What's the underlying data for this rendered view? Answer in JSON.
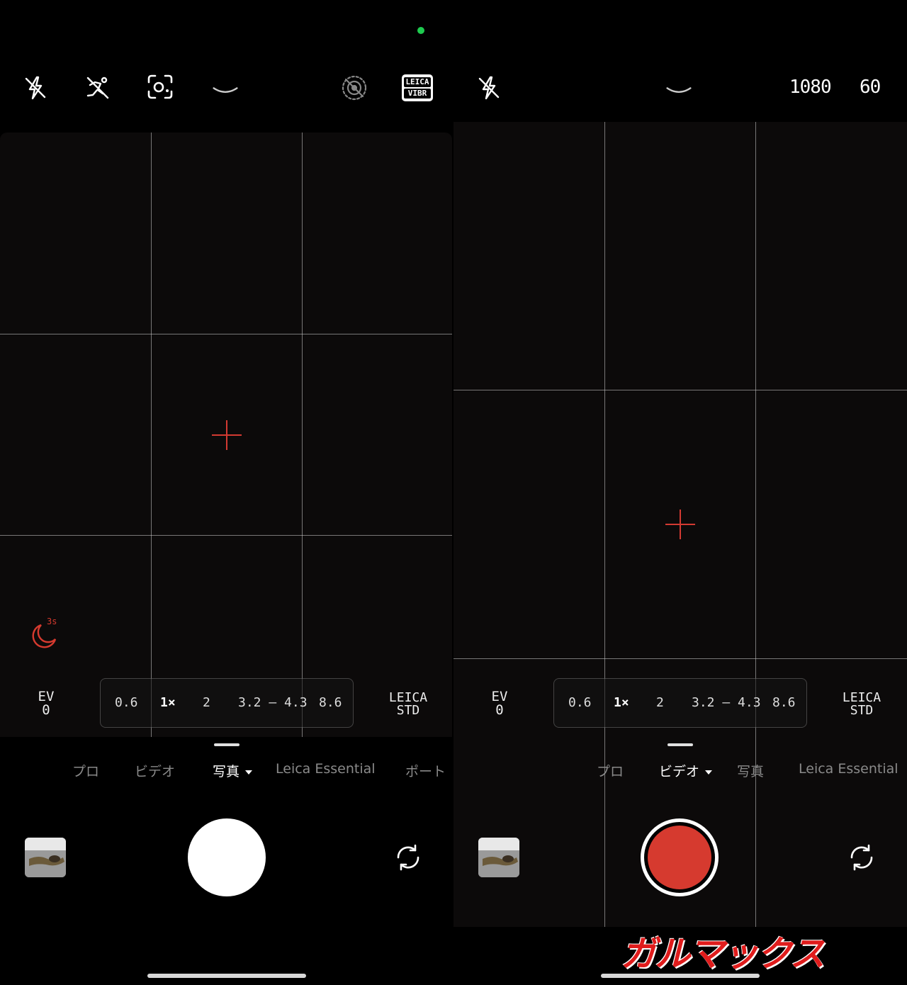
{
  "photo_screen": {
    "top_bar_icons": [
      "flash-off-icon",
      "motion-off-icon",
      "lens-scan-icon",
      "chevron-down-icon",
      "live-photo-off-icon",
      "leica-vibrant-badge"
    ],
    "leica_badge": {
      "line1": "LEICA",
      "line2": "VIBR"
    },
    "night_timer_label": "3s",
    "ev": {
      "label": "EV",
      "value": "0"
    },
    "zoom_levels": [
      "0.6",
      "1×",
      "2",
      "3.2 – 4.3",
      "8.6"
    ],
    "color_profile": {
      "line1": "LEICA",
      "line2": "STD"
    },
    "modes": [
      "プロ",
      "ビデオ",
      "写真",
      "Leica Essential",
      "ポート"
    ],
    "active_mode": "写真"
  },
  "video_screen": {
    "top_bar_icons": [
      "flash-off-icon",
      "chevron-down-icon"
    ],
    "resolution": "1080",
    "fps": "60",
    "ev": {
      "label": "EV",
      "value": "0"
    },
    "zoom_levels": [
      "0.6",
      "1×",
      "2",
      "3.2 – 4.3",
      "8.6"
    ],
    "color_profile": {
      "line1": "LEICA",
      "line2": "STD"
    },
    "modes": [
      "プロ",
      "ビデオ",
      "写真",
      "Leica Essential"
    ],
    "active_mode": "ビデオ"
  },
  "watermark": "ガルマックス",
  "colors": {
    "accent_red": "#d63a2f",
    "recording_indicator": "#1ecb4f",
    "viewfinder_bg": "#0c0a0a"
  }
}
